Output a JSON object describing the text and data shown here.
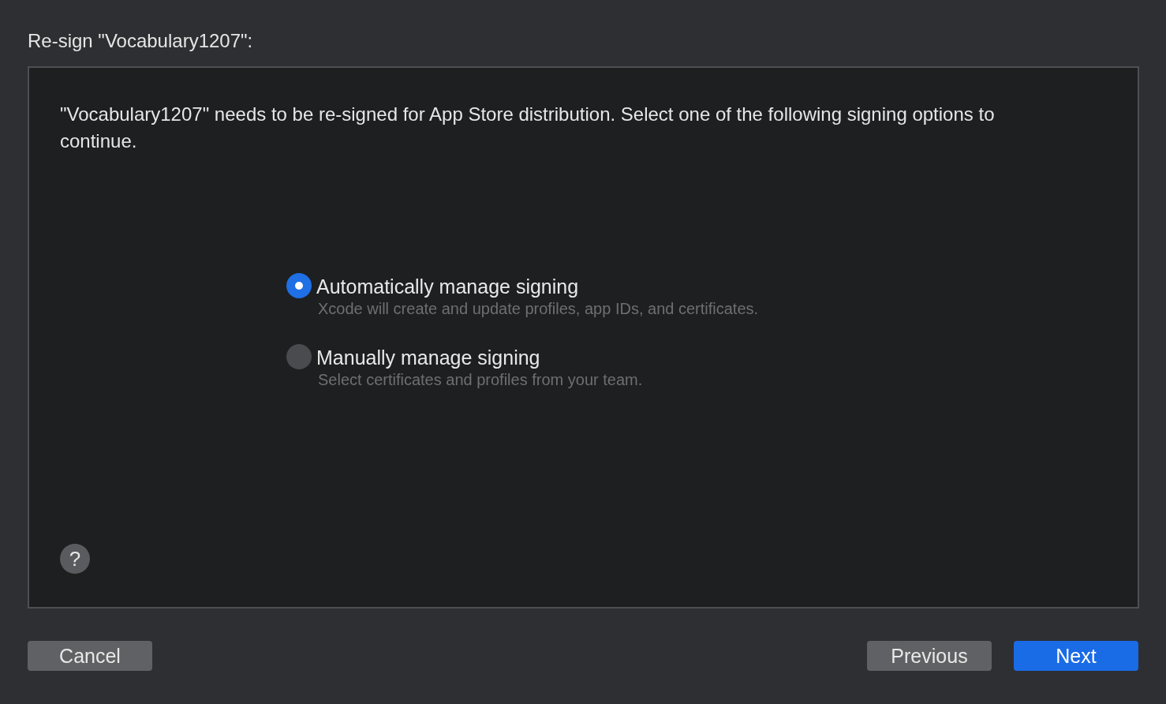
{
  "window": {
    "title": "Re-sign \"Vocabulary1207\":"
  },
  "message": "\"Vocabulary1207\" needs to be re-signed for App Store distribution. Select one of the following signing options to continue.",
  "options": [
    {
      "label": "Automatically manage signing",
      "description": "Xcode will create and update profiles, app IDs, and certificates.",
      "selected": true
    },
    {
      "label": "Manually manage signing",
      "description": "Select certificates and profiles from your team.",
      "selected": false
    }
  ],
  "help_button": "?",
  "buttons": [
    {
      "label": "Cancel",
      "kind": "secondary"
    },
    {
      "label": "Previous",
      "kind": "secondary"
    },
    {
      "label": "Next",
      "kind": "primary"
    }
  ]
}
